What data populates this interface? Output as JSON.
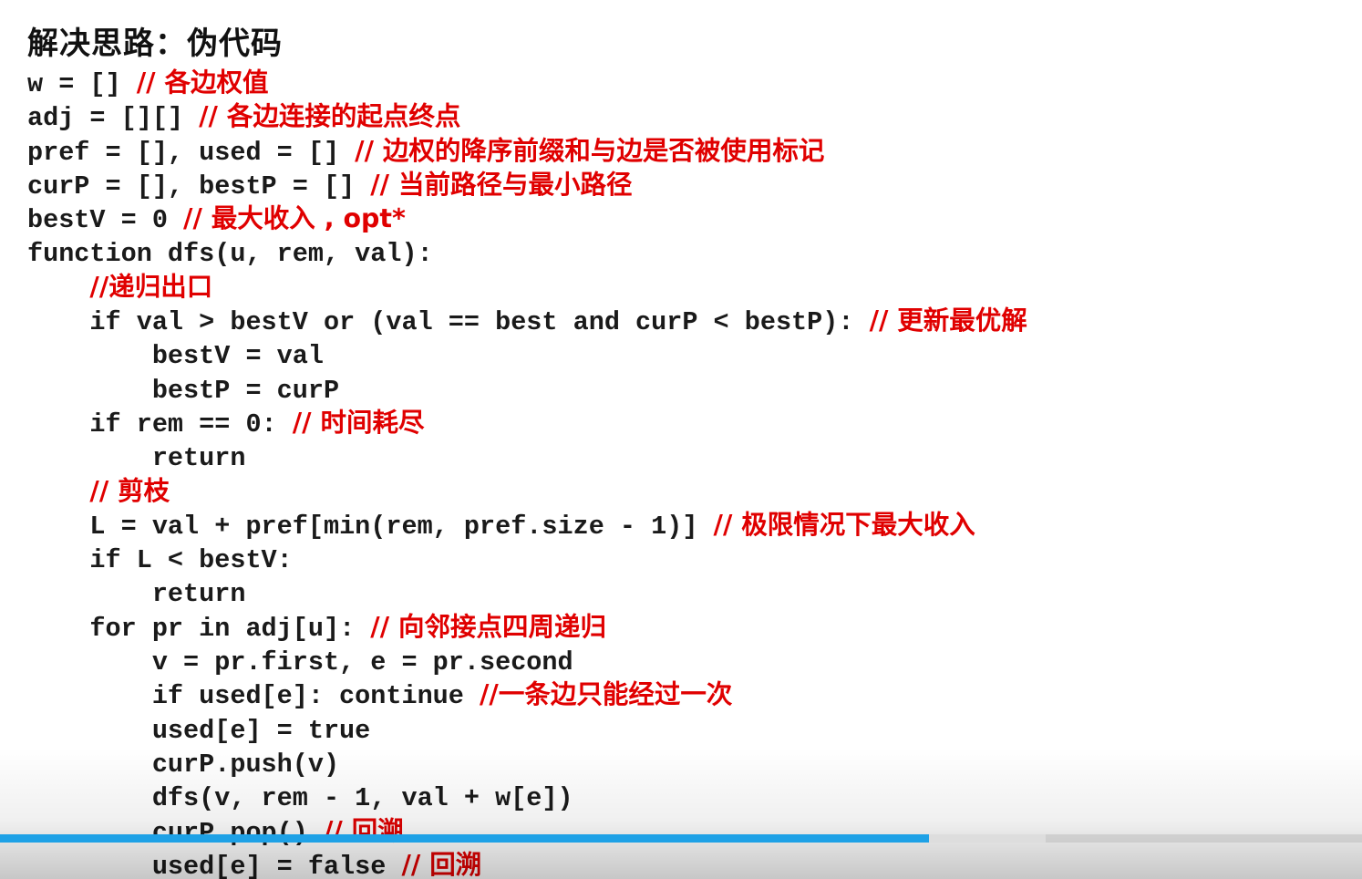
{
  "slide": {
    "title": "解决思路：伪代码",
    "code_lines": [
      {
        "indent": 0,
        "code": "w = [] ",
        "comment": "// 各边权值"
      },
      {
        "indent": 0,
        "code": "adj = [][] ",
        "comment": "// 各边连接的起点终点"
      },
      {
        "indent": 0,
        "code": "pref = [], used = [] ",
        "comment": "// 边权的降序前缀和与边是否被使用标记"
      },
      {
        "indent": 0,
        "code": "curP = [], bestP = [] ",
        "comment": "// 当前路径与最小路径"
      },
      {
        "indent": 0,
        "code": "bestV = 0 ",
        "comment": "// 最大收入 , opt*"
      },
      {
        "indent": 0,
        "code": "function dfs(u, rem, val):",
        "comment": ""
      },
      {
        "indent": 4,
        "code": "",
        "comment": "//递归出口"
      },
      {
        "indent": 4,
        "code": "if val > bestV or (val == best and curP < bestP): ",
        "comment": "// 更新最优解"
      },
      {
        "indent": 8,
        "code": "bestV = val",
        "comment": ""
      },
      {
        "indent": 8,
        "code": "bestP = curP",
        "comment": ""
      },
      {
        "indent": 4,
        "code": "if rem == 0: ",
        "comment": "// 时间耗尽"
      },
      {
        "indent": 8,
        "code": "return",
        "comment": ""
      },
      {
        "indent": 4,
        "code": "",
        "comment": "// 剪枝"
      },
      {
        "indent": 4,
        "code": "L = val + pref[min(rem, pref.size - 1)] ",
        "comment": "// 极限情况下最大收入"
      },
      {
        "indent": 4,
        "code": "if L < bestV:",
        "comment": ""
      },
      {
        "indent": 8,
        "code": "return",
        "comment": ""
      },
      {
        "indent": 4,
        "code": "for pr in adj[u]: ",
        "comment": "// 向邻接点四周递归"
      },
      {
        "indent": 8,
        "code": "v = pr.first, e = pr.second",
        "comment": ""
      },
      {
        "indent": 8,
        "code": "if used[e]: continue ",
        "comment": "//一条边只能经过一次"
      },
      {
        "indent": 8,
        "code": "used[e] = true",
        "comment": ""
      },
      {
        "indent": 8,
        "code": "curP.push(v)",
        "comment": ""
      },
      {
        "indent": 8,
        "code": "dfs(v, rem - 1, val + w[e])",
        "comment": ""
      },
      {
        "indent": 8,
        "code": "curP.pop() ",
        "comment": "// 回溯"
      },
      {
        "indent": 8,
        "code": "used[e] = false ",
        "comment": "// 回溯"
      }
    ]
  },
  "player": {
    "progress_fraction": 0.682,
    "buffered_fraction": 0.768
  },
  "colors": {
    "comment": "#e00000",
    "code": "#1a1a1a",
    "progress": "#1ea1e6"
  }
}
